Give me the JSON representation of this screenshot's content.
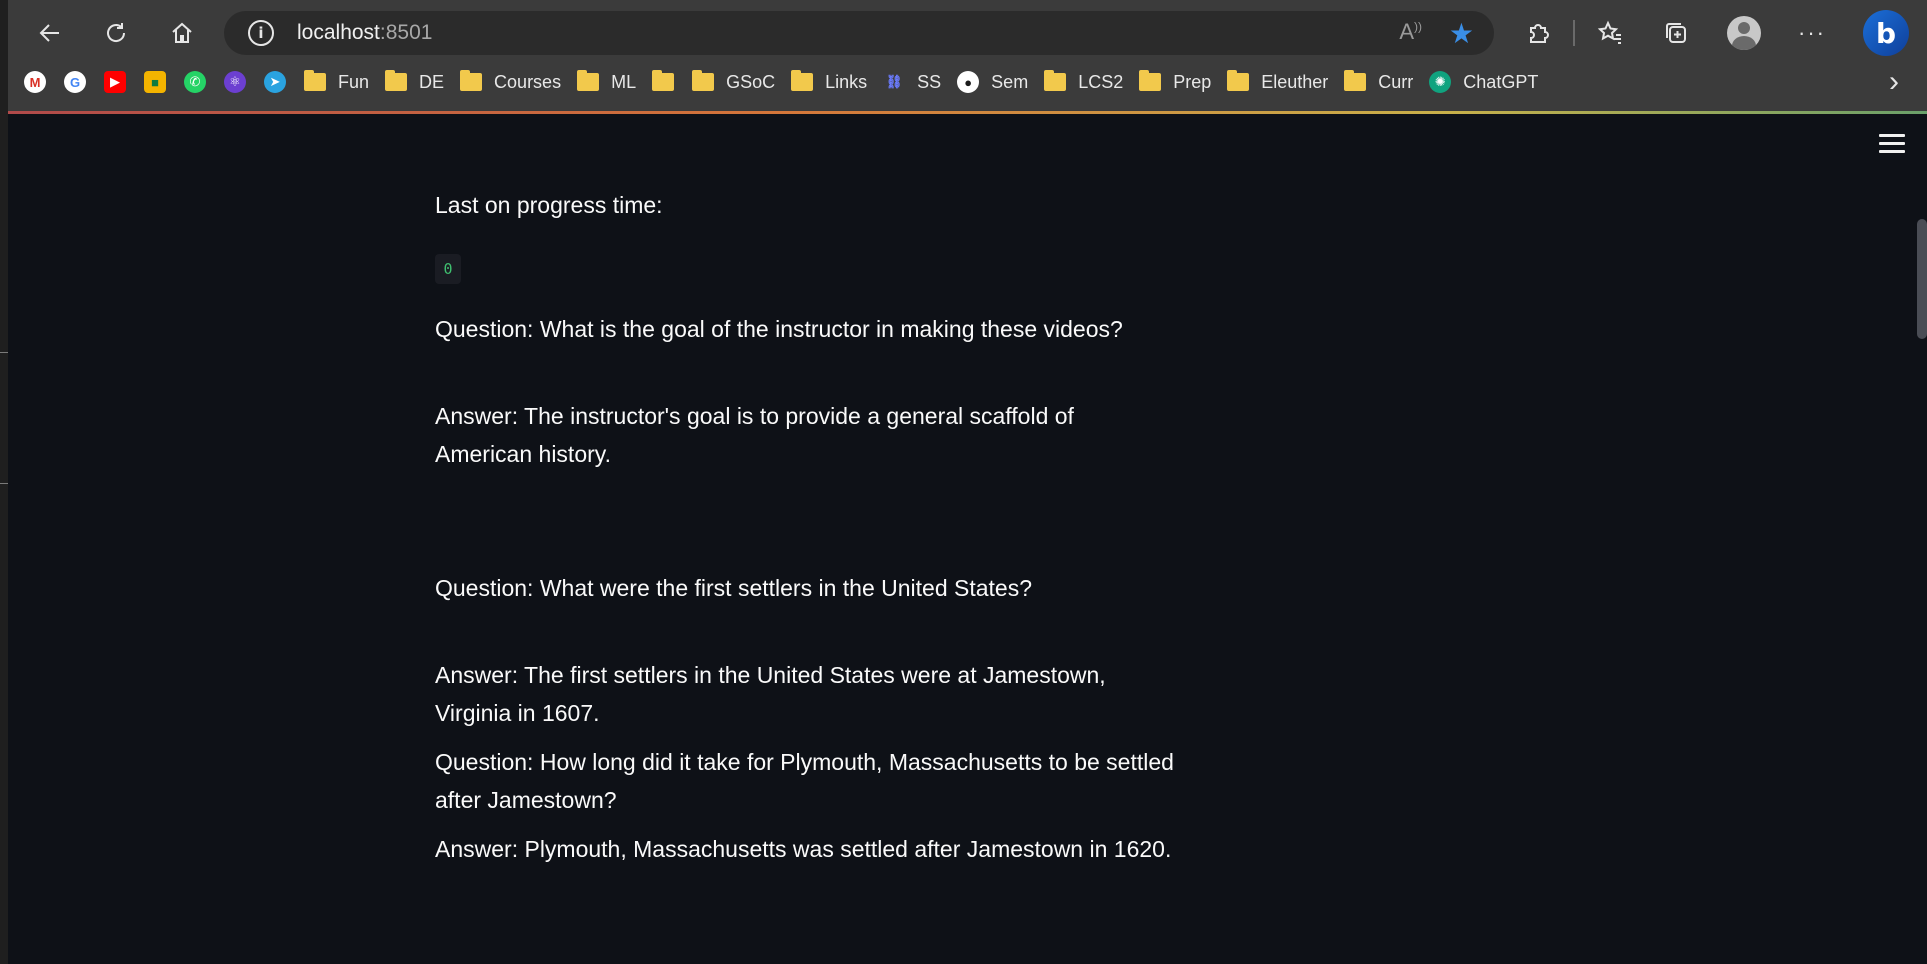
{
  "browser": {
    "url_host": "localhost",
    "url_port": ":8501",
    "read_aloud_icon": "read-aloud-icon",
    "favorite_icon": "star-filled-icon",
    "accent_color": "#3a8ee6",
    "bookmarks": [
      {
        "label": "",
        "icon": "gmail-icon"
      },
      {
        "label": "",
        "icon": "google-icon"
      },
      {
        "label": "",
        "icon": "youtube-icon"
      },
      {
        "label": "",
        "icon": "classroom-icon"
      },
      {
        "label": "",
        "icon": "whatsapp-icon"
      },
      {
        "label": "",
        "icon": "react-icon"
      },
      {
        "label": "",
        "icon": "telegram-icon"
      },
      {
        "label": "Fun",
        "icon": "folder-icon"
      },
      {
        "label": "DE",
        "icon": "folder-icon"
      },
      {
        "label": "Courses",
        "icon": "folder-icon"
      },
      {
        "label": "ML",
        "icon": "folder-icon"
      },
      {
        "label": "",
        "icon": "folder-icon"
      },
      {
        "label": "GSoC",
        "icon": "folder-icon"
      },
      {
        "label": "Links",
        "icon": "folder-icon"
      },
      {
        "label": "SS",
        "icon": "link-icon"
      },
      {
        "label": "Sem",
        "icon": "github-icon"
      },
      {
        "label": "LCS2",
        "icon": "folder-icon"
      },
      {
        "label": "Prep",
        "icon": "folder-icon"
      },
      {
        "label": "Eleuther",
        "icon": "folder-icon"
      },
      {
        "label": "Curr",
        "icon": "folder-icon"
      },
      {
        "label": "ChatGPT",
        "icon": "chatgpt-icon"
      }
    ]
  },
  "app": {
    "progress_label": "Last on progress time:",
    "progress_value": "0",
    "qa": [
      "Question: What is the goal of the instructor in making these videos?",
      "Answer: The instructor's goal is to provide a general scaffold of American history.",
      "Question: What were the first settlers in the United States?",
      "Answer: The first settlers in the United States were at Jamestown, Virginia in 1607.",
      "Question: How long did it take for Plymouth, Massachusetts to be settled after Jamestown?",
      "Answer: Plymouth, Massachusetts was settled after Jamestown in 1620."
    ]
  }
}
